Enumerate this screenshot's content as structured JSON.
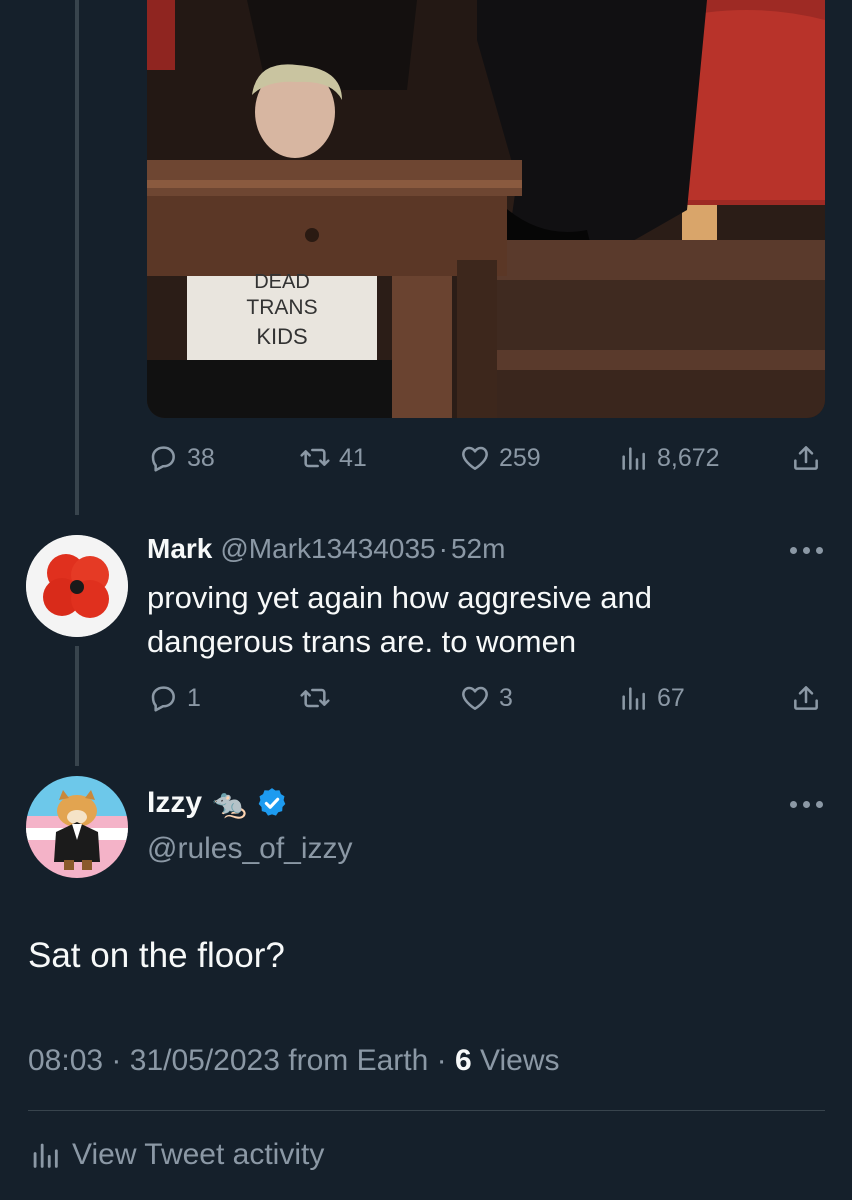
{
  "tweet_photo": {
    "shirt_text": [
      "DEAD",
      "TRANS",
      "KIDS"
    ]
  },
  "original_tweet": {
    "replies": "38",
    "retweets": "41",
    "likes": "259",
    "views": "8,672"
  },
  "reply": {
    "name": "Mark",
    "handle": "@Mark13434035",
    "separator": "·",
    "time": "52m",
    "text": "proving yet again  how aggresive and dangerous trans  are. to women",
    "replies": "1",
    "retweets": "",
    "likes": "3",
    "views": "67"
  },
  "main_tweet": {
    "name": "Izzy",
    "name_emoji": "🐀",
    "handle": "@rules_of_izzy",
    "text": "Sat on the floor?",
    "time": "08:03",
    "date": "31/05/2023",
    "source": "from Earth",
    "sep": "·",
    "views_count": "6",
    "views_label": "Views"
  },
  "activity": {
    "label": "View Tweet activity"
  },
  "icons": {
    "reply": "reply-icon",
    "retweet": "retweet-icon",
    "like": "heart-icon",
    "views": "views-icon",
    "share": "share-icon",
    "more": "more-icon",
    "verified": "verified-badge-icon"
  },
  "colors": {
    "background": "#15202b",
    "muted": "#8b98a5",
    "verified": "#1d9bf0",
    "poppy": "#e0301e"
  }
}
